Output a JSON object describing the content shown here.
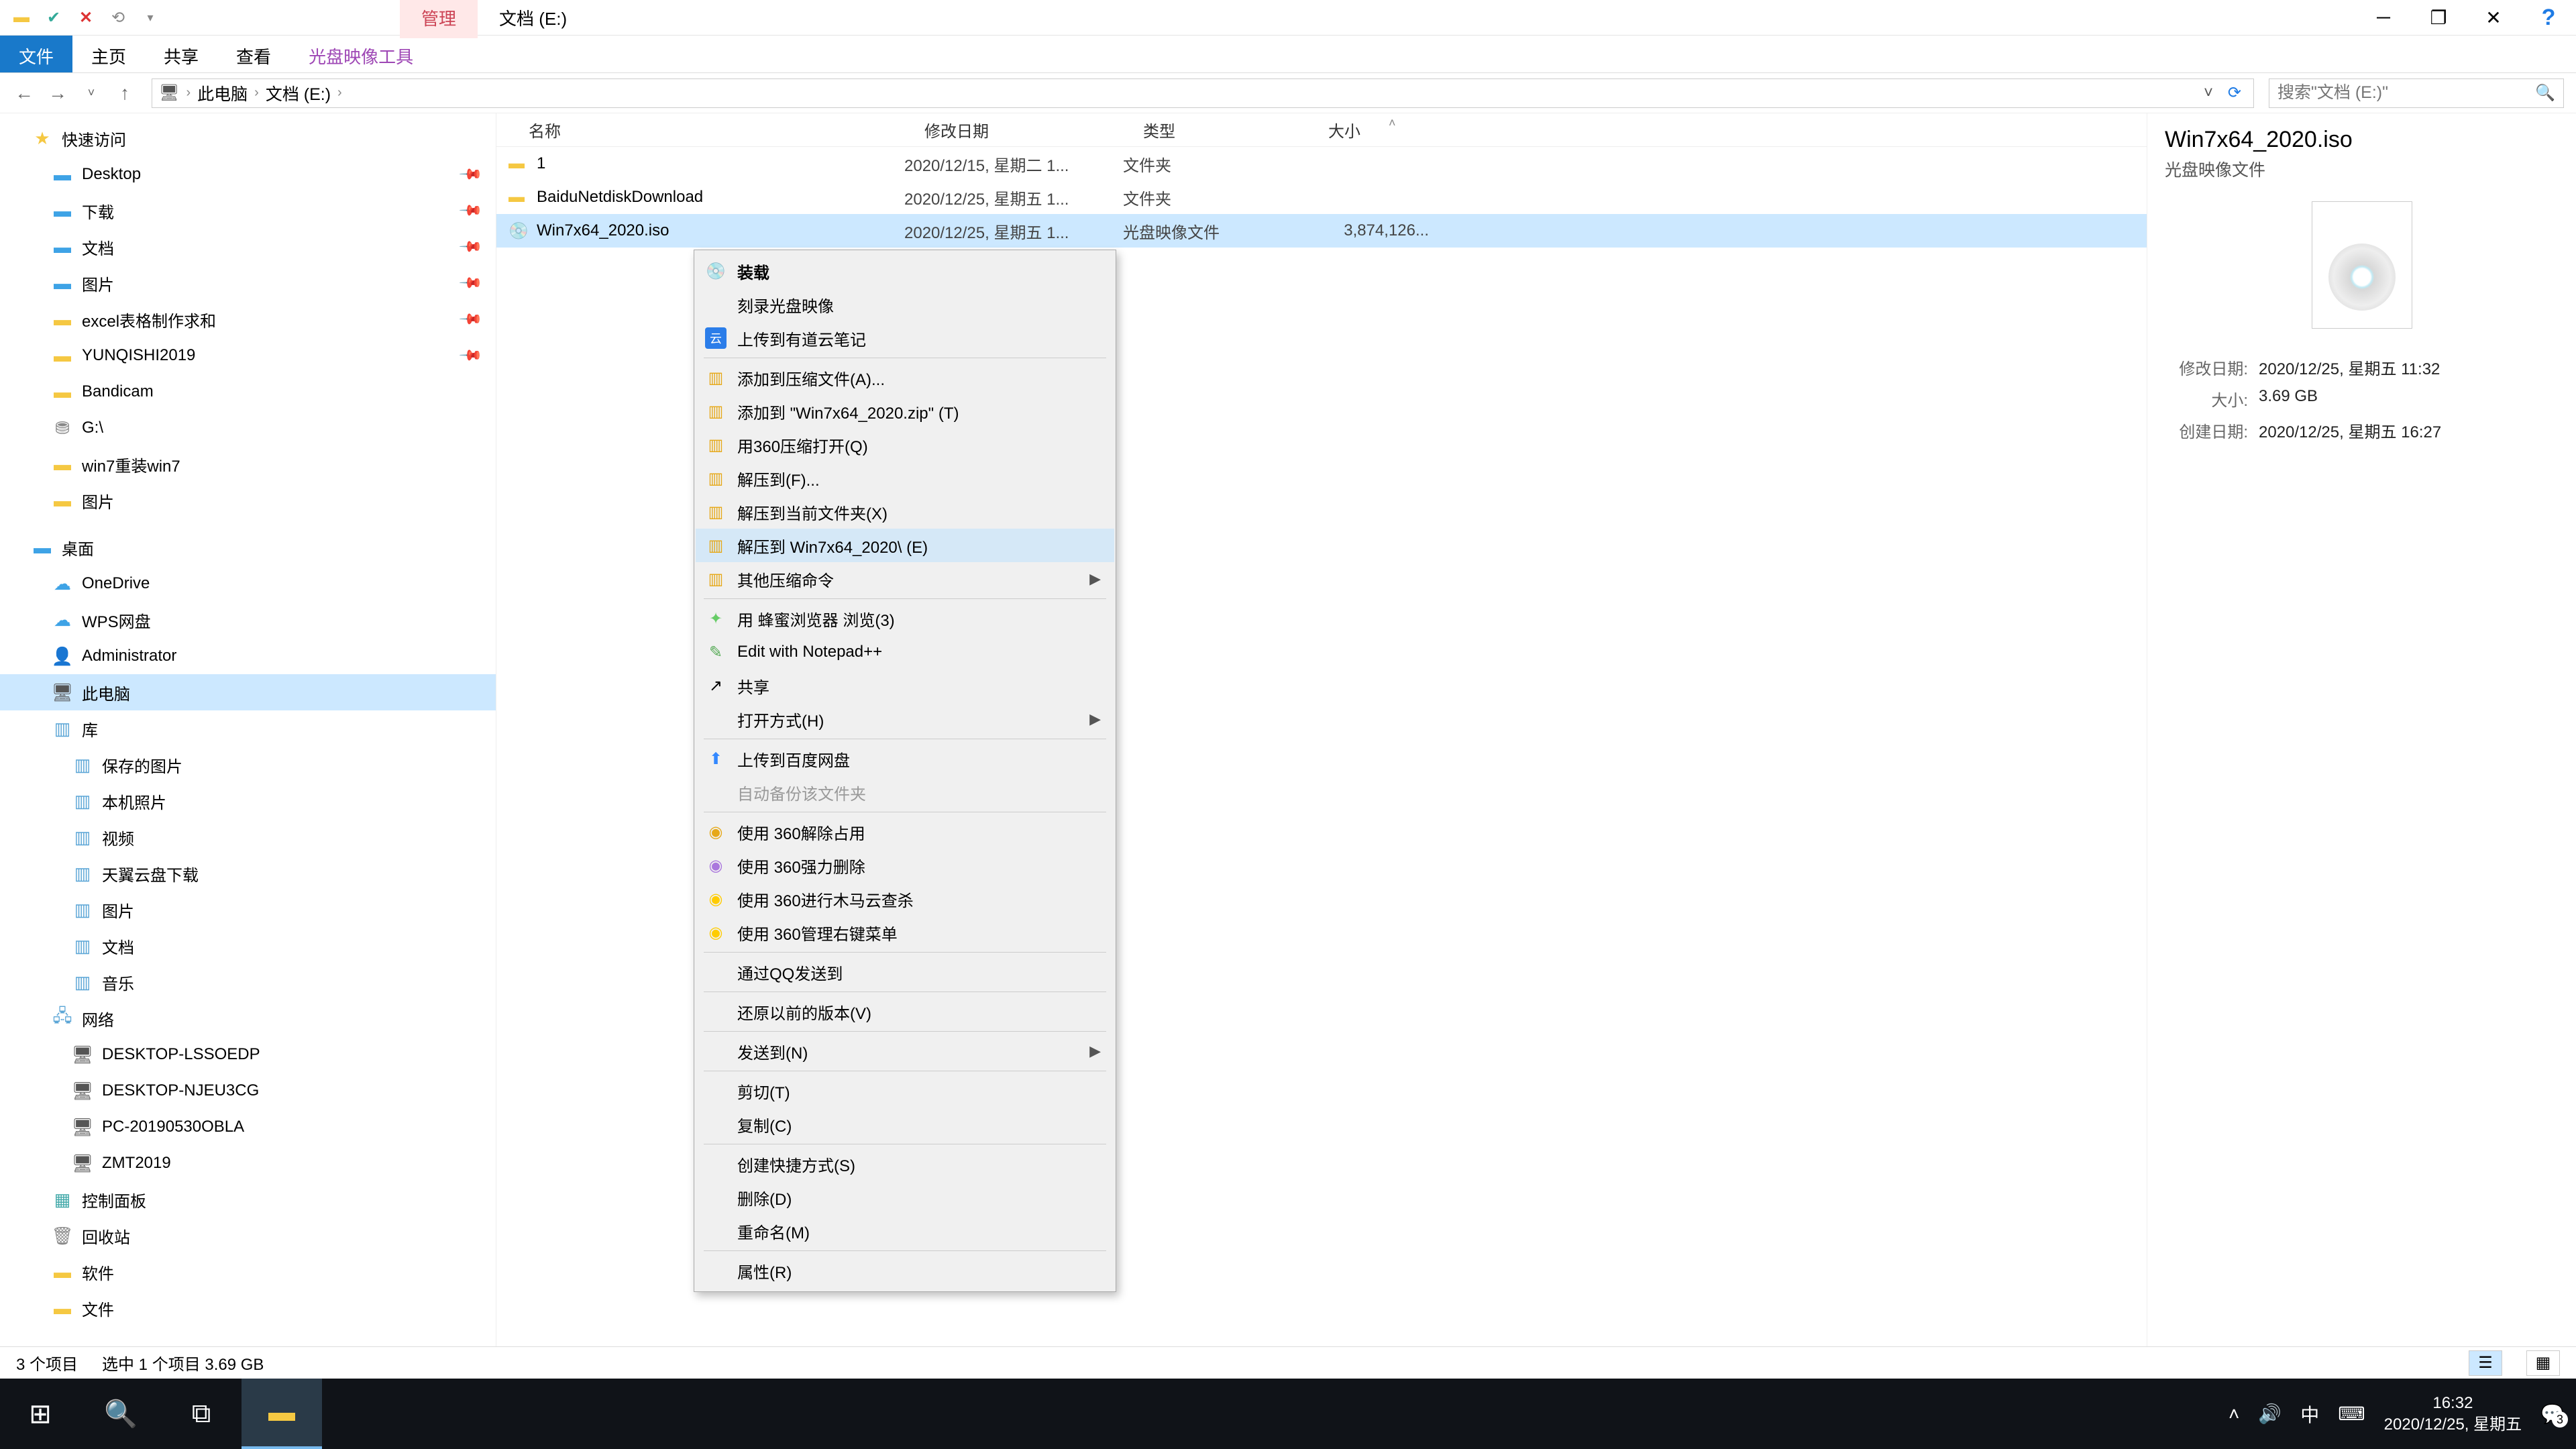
{
  "titlebar": {
    "tab_manage": "管理",
    "tab_location": "文档 (E:)"
  },
  "ribbon": {
    "file": "文件",
    "home": "主页",
    "share": "共享",
    "view": "查看",
    "tool": "光盘映像工具"
  },
  "nav": {
    "crumb1": "此电脑",
    "crumb2": "文档 (E:)",
    "search_placeholder": "搜索\"文档 (E:)\""
  },
  "tree": {
    "quick": "快速访问",
    "desktop": "Desktop",
    "downloads": "下载",
    "documents": "文档",
    "pictures": "图片",
    "excel": "excel表格制作求和",
    "yunqishi": "YUNQISHI2019",
    "bandicam": "Bandicam",
    "gdrive": "G:\\",
    "win7fix": "win7重装win7",
    "pictures2": "图片",
    "desktop2": "桌面",
    "onedrive": "OneDrive",
    "wps": "WPS网盘",
    "admin": "Administrator",
    "thispc": "此电脑",
    "library": "库",
    "saved_pics": "保存的图片",
    "local_photos": "本机照片",
    "videos": "视频",
    "tianyi": "天翼云盘下载",
    "pics_lib": "图片",
    "docs_lib": "文档",
    "music_lib": "音乐",
    "network": "网络",
    "net1": "DESKTOP-LSSOEDP",
    "net2": "DESKTOP-NJEU3CG",
    "net3": "PC-20190530OBLA",
    "net4": "ZMT2019",
    "cpanel": "控制面板",
    "recycle": "回收站",
    "software": "软件",
    "files": "文件"
  },
  "cols": {
    "name": "名称",
    "date": "修改日期",
    "type": "类型",
    "size": "大小"
  },
  "rows": [
    {
      "name": "1",
      "date": "2020/12/15, 星期二 1...",
      "type": "文件夹",
      "size": ""
    },
    {
      "name": "BaiduNetdiskDownload",
      "date": "2020/12/25, 星期五 1...",
      "type": "文件夹",
      "size": ""
    },
    {
      "name": "Win7x64_2020.iso",
      "date": "2020/12/25, 星期五 1...",
      "type": "光盘映像文件",
      "size": "3,874,126..."
    }
  ],
  "ctx": {
    "mount": "装载",
    "burn": "刻录光盘映像",
    "youdao": "上传到有道云笔记",
    "add_archive": "添加到压缩文件(A)...",
    "add_zip": "添加到 \"Win7x64_2020.zip\" (T)",
    "open360": "用360压缩打开(Q)",
    "extract_to": "解压到(F)...",
    "extract_here": "解压到当前文件夹(X)",
    "extract_named": "解压到 Win7x64_2020\\ (E)",
    "other_compress": "其他压缩命令",
    "honey": "用 蜂蜜浏览器 浏览(3)",
    "notepadpp": "Edit with Notepad++",
    "share": "共享",
    "open_with": "打开方式(H)",
    "baidu_upload": "上传到百度网盘",
    "auto_backup": "自动备份该文件夹",
    "u360_unlock": "使用 360解除占用",
    "u360_delete": "使用 360强力删除",
    "u360_scan": "使用 360进行木马云查杀",
    "u360_menu": "使用 360管理右键菜单",
    "qq_send": "通过QQ发送到",
    "restore": "还原以前的版本(V)",
    "send_to": "发送到(N)",
    "cut": "剪切(T)",
    "copy": "复制(C)",
    "shortcut": "创建快捷方式(S)",
    "delete": "删除(D)",
    "rename": "重命名(M)",
    "props": "属性(R)"
  },
  "preview": {
    "title": "Win7x64_2020.iso",
    "subtitle": "光盘映像文件",
    "mod_label": "修改日期:",
    "mod_val": "2020/12/25, 星期五 11:32",
    "size_label": "大小:",
    "size_val": "3.69 GB",
    "created_label": "创建日期:",
    "created_val": "2020/12/25, 星期五 16:27"
  },
  "status": {
    "count": "3 个项目",
    "selected": "选中 1 个项目  3.69 GB"
  },
  "taskbar": {
    "ime": "中",
    "time": "16:32",
    "date": "2020/12/25, 星期五",
    "badge": "3"
  }
}
